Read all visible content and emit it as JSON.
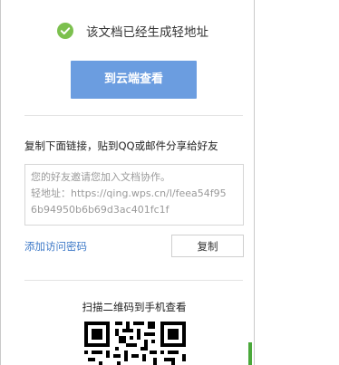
{
  "status": {
    "message": "该文档已经生成轻地址"
  },
  "cloud_button": {
    "label": "到云端查看"
  },
  "share": {
    "instruction": "复制下面链接，贴到QQ或邮件分享给好友",
    "link_lines": [
      "您的好友邀请您加入文档协作。",
      "轻地址：https://qing.wps.cn/l/feea54f95",
      "6b94950b6b69d3ac401fc1f"
    ],
    "add_password_label": "添加访问密码",
    "copy_label": "复制"
  },
  "qr": {
    "caption": "扫描二维码到手机查看",
    "icon": "qr-code"
  },
  "colors": {
    "primary_button": "#6b9de0",
    "success": "#7cc04e",
    "link": "#3f7ac8",
    "strip": "#4aa83a"
  }
}
